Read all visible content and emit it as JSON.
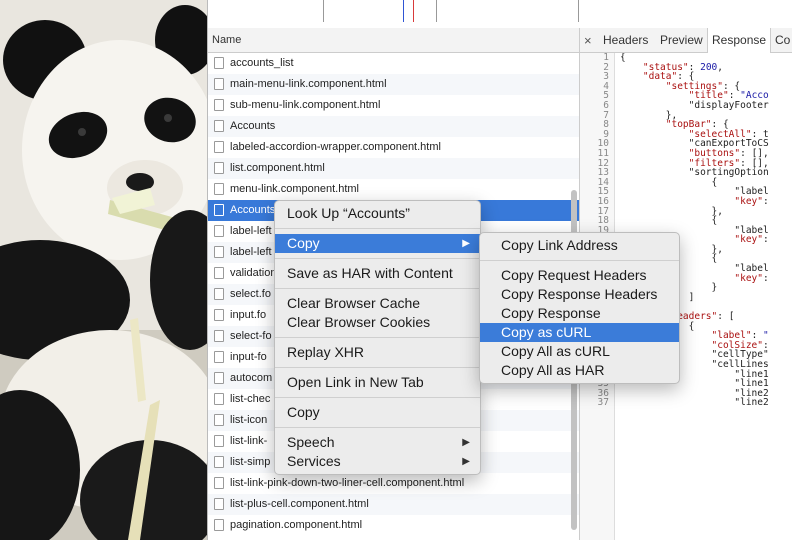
{
  "name_column_header": "Name",
  "requests": [
    "accounts_list",
    "main-menu-link.component.html",
    "sub-menu-link.component.html",
    "Accounts",
    "labeled-accordion-wrapper.component.html",
    "list.component.html",
    "menu-link.component.html",
    "Accounts",
    "label-left",
    "label-left",
    "validation",
    "select.fo",
    "input.fo",
    "select-fo",
    "input-fo",
    "autocom",
    "list-chec",
    "list-icon",
    "list-link-",
    "list-simp",
    "list-link-pink-down-two-liner-cell.component.html",
    "list-plus-cell.component.html",
    "pagination.component.html"
  ],
  "selected_index": 7,
  "detail_tabs": {
    "close": "×",
    "headers": "Headers",
    "preview": "Preview",
    "response": "Response",
    "cookies": "Co"
  },
  "response_lines": [
    "{",
    "    \"status\": 200,",
    "    \"data\": {",
    "        \"settings\": {",
    "            \"title\": \"Acco",
    "            \"displayFooter",
    "        },",
    "        \"topBar\": {",
    "            \"selectAll\": t",
    "            \"canExportToCS",
    "            \"buttons\": [],",
    "            \"filters\": [],",
    "            \"sortingOption",
    "                {",
    "                    \"label",
    "                    \"key\":",
    "                },",
    "                {",
    "                    \"label",
    "                    \"key\":",
    "                },",
    "                {",
    "                    \"label",
    "                    \"key\":",
    "                }",
    "            ]",
    "        },",
    "        \"headers\": [",
    "            {",
    "                \"label\": \"",
    "                \"colSize\":",
    "                \"cellType\"",
    "                \"cellLines",
    "                    \"line1",
    "                    \"line1",
    "                    \"line2",
    "                    \"line2"
  ],
  "context_menu": {
    "look_up": "Look Up “Accounts”",
    "copy_submenu": "Copy",
    "save_har": "Save as HAR with Content",
    "clear_cache": "Clear Browser Cache",
    "clear_cookies": "Clear Browser Cookies",
    "replay_xhr": "Replay XHR",
    "open_link": "Open Link in New Tab",
    "copy": "Copy",
    "speech": "Speech",
    "services": "Services"
  },
  "copy_submenu": {
    "link_address": "Copy Link Address",
    "request_headers": "Copy Request Headers",
    "response_headers": "Copy Response Headers",
    "response": "Copy Response",
    "as_curl": "Copy as cURL",
    "all_as_curl": "Copy All as cURL",
    "all_as_har": "Copy All as HAR"
  },
  "submenu_arrow": "▶",
  "colors": {
    "selection": "#3879d9",
    "menu_highlight": "#3b7cd9",
    "timeline_blue": "#2f55d4",
    "timeline_red": "#d83a3a"
  }
}
